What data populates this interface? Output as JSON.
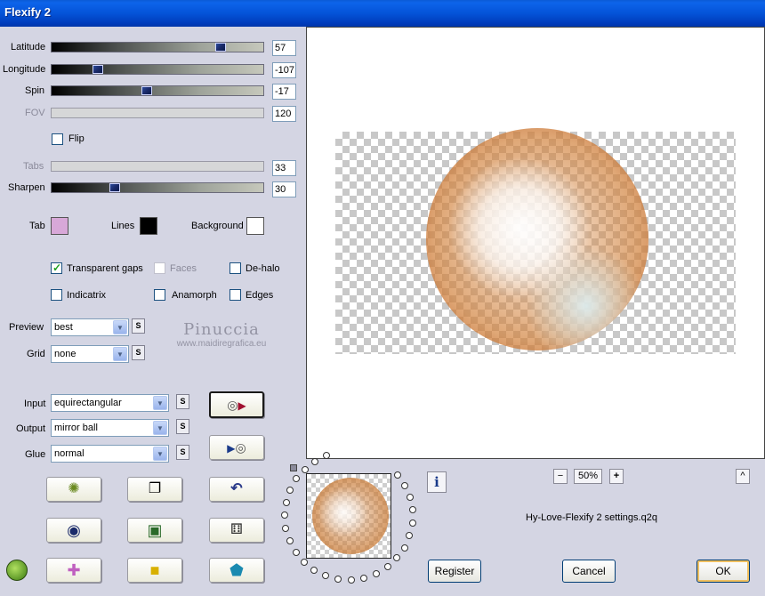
{
  "window": {
    "title": "Flexify 2"
  },
  "sliders": [
    {
      "label": "Latitude",
      "value": "57",
      "fraction": 0.8,
      "enabled": true
    },
    {
      "label": "Longitude",
      "value": "-107",
      "fraction": 0.22,
      "enabled": true
    },
    {
      "label": "Spin",
      "value": "-17",
      "fraction": 0.45,
      "enabled": true
    },
    {
      "label": "FOV",
      "value": "120",
      "fraction": null,
      "enabled": false
    },
    {
      "label": "Tabs",
      "value": "33",
      "fraction": null,
      "enabled": false
    },
    {
      "label": "Sharpen",
      "value": "30",
      "fraction": 0.3,
      "enabled": true
    }
  ],
  "flip": {
    "label": "Flip",
    "checked": false
  },
  "colors": {
    "tab": {
      "label": "Tab",
      "value": "#d8a8d8"
    },
    "lines": {
      "label": "Lines",
      "value": "#000000"
    },
    "background": {
      "label": "Background",
      "value": "#ffffff"
    }
  },
  "options": {
    "transparent_gaps": {
      "label": "Transparent gaps",
      "checked": true
    },
    "faces": {
      "label": "Faces",
      "checked": false
    },
    "de_halo": {
      "label": "De-halo",
      "checked": false
    },
    "indicatrix": {
      "label": "Indicatrix",
      "checked": false
    },
    "anamorph": {
      "label": "Anamorph",
      "checked": false
    },
    "edges": {
      "label": "Edges",
      "checked": false
    }
  },
  "preview_select": {
    "label": "Preview",
    "value": "best"
  },
  "grid_select": {
    "label": "Grid",
    "value": "none"
  },
  "input_select": {
    "label": "Input",
    "value": "equirectangular"
  },
  "output_select": {
    "label": "Output",
    "value": "mirror ball"
  },
  "glue_select": {
    "label": "Glue",
    "value": "normal"
  },
  "s_label": "S",
  "watermark": {
    "line1": "Pinuccia",
    "line2": "www.maidiregrafica.eu"
  },
  "zoom": {
    "minus": "−",
    "value": "50%",
    "plus": "+"
  },
  "up_label": "^",
  "info_label": "i",
  "preset_name": "Hy-Love-Flexify 2 settings.q2q",
  "buttons": {
    "register": "Register",
    "cancel": "Cancel",
    "ok": "OK"
  },
  "accent": {
    "title_bar": "#0453d8",
    "ok_border": "#f0c060"
  }
}
